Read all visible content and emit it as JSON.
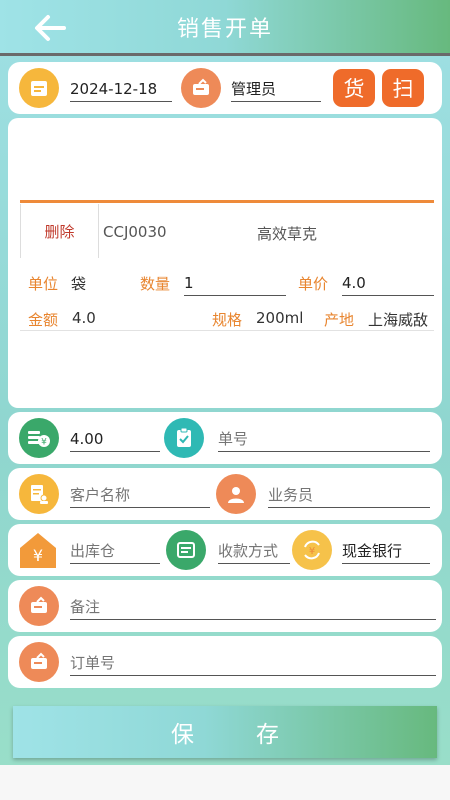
{
  "header": {
    "title": "销售开单"
  },
  "top_row": {
    "date": "2024-12-18",
    "operator": "管理员",
    "goods_button": "货",
    "scan_button": "扫"
  },
  "item": {
    "delete_label": "删除",
    "code": "CCJ0030",
    "name": "高效草克",
    "unit_label": "单位",
    "unit_value": "袋",
    "qty_label": "数量",
    "qty_value": "1",
    "price_label": "单价",
    "price_value": "4.0",
    "amount_label": "金额",
    "amount_value": "4.0",
    "spec_label": "规格",
    "spec_value": "200ml",
    "origin_label": "产地",
    "origin_value": "上海威敌"
  },
  "totals": {
    "amount": "4.00",
    "order_no_placeholder": "单号"
  },
  "customer": {
    "customer_placeholder": "客户名称",
    "salesman_placeholder": "业务员"
  },
  "payment": {
    "warehouse_placeholder": "出库仓",
    "method_placeholder": "收款方式",
    "account_value": "现金银行"
  },
  "remark": {
    "placeholder": "备注"
  },
  "order": {
    "placeholder": "订单号"
  },
  "footer": {
    "save_label": "保存"
  },
  "colors": {
    "accent_orange": "#ef6b2a",
    "label_orange": "#e8852f",
    "icon_orange": "#ee8a58",
    "icon_yellow": "#f6b73c",
    "icon_teal": "#2fb9b4",
    "icon_green": "#3aa86a",
    "delete_red": "#c0392b"
  }
}
